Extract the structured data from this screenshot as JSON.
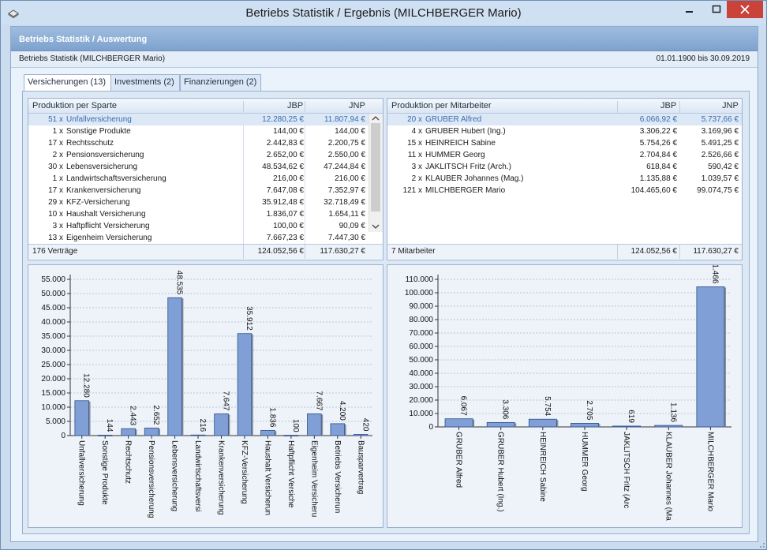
{
  "window": {
    "title": "Betriebs Statistik / Ergebnis (MILCHBERGER Mario)"
  },
  "header": {
    "title": "Betriebs Statistik / Auswertung"
  },
  "subheader": {
    "left": "Betriebs Statistik (MILCHBERGER Mario)",
    "right": "01.01.1900 bis 30.09.2019"
  },
  "tabs": [
    {
      "label": "Versicherungen (13)",
      "active": true
    },
    {
      "label": "Investments (2)",
      "active": false
    },
    {
      "label": "Finanzierungen (2)",
      "active": false
    }
  ],
  "sparte_grid": {
    "columns": [
      "Produktion per Sparte",
      "JBP",
      "JNP"
    ],
    "rows": [
      {
        "count": "51 x",
        "name": "Unfallversicherung",
        "jbp": "12.280,25 €",
        "jnp": "11.807,94 €",
        "selected": true
      },
      {
        "count": "1 x",
        "name": "Sonstige Produkte",
        "jbp": "144,00 €",
        "jnp": "144,00 €"
      },
      {
        "count": "17 x",
        "name": "Rechtsschutz",
        "jbp": "2.442,83 €",
        "jnp": "2.200,75 €"
      },
      {
        "count": "2 x",
        "name": "Pensionsversicherung",
        "jbp": "2.652,00 €",
        "jnp": "2.550,00 €"
      },
      {
        "count": "30 x",
        "name": "Lebensversicherung",
        "jbp": "48.534,62 €",
        "jnp": "47.244,84 €"
      },
      {
        "count": "1 x",
        "name": "Landwirtschaftsversicherung",
        "jbp": "216,00 €",
        "jnp": "216,00 €"
      },
      {
        "count": "17 x",
        "name": "Krankenversicherung",
        "jbp": "7.647,08 €",
        "jnp": "7.352,97 €"
      },
      {
        "count": "29 x",
        "name": "KFZ-Versicherung",
        "jbp": "35.912,48 €",
        "jnp": "32.718,49 €"
      },
      {
        "count": "10 x",
        "name": "Haushalt Versicherung",
        "jbp": "1.836,07 €",
        "jnp": "1.654,11 €"
      },
      {
        "count": "3 x",
        "name": "Haftpflicht Versicherung",
        "jbp": "100,00 €",
        "jnp": "90,09 €"
      },
      {
        "count": "13 x",
        "name": "Eigenheim Versicherung",
        "jbp": "7.667,23 €",
        "jnp": "7.447,30 €"
      }
    ],
    "footer": {
      "label": "176 Verträge",
      "jbp": "124.052,56 €",
      "jnp": "117.630,27 €"
    }
  },
  "mitarbeiter_grid": {
    "columns": [
      "Produktion per Mitarbeiter",
      "JBP",
      "JNP"
    ],
    "rows": [
      {
        "count": "20 x",
        "name": "GRUBER Alfred",
        "jbp": "6.066,92 €",
        "jnp": "5.737,66 €",
        "selected": true
      },
      {
        "count": "4 x",
        "name": "GRUBER Hubert (Ing.)",
        "jbp": "3.306,22 €",
        "jnp": "3.169,96 €"
      },
      {
        "count": "15 x",
        "name": "HEINREICH Sabine",
        "jbp": "5.754,26 €",
        "jnp": "5.491,25 €"
      },
      {
        "count": "11 x",
        "name": "HUMMER Georg",
        "jbp": "2.704,84 €",
        "jnp": "2.526,66 €"
      },
      {
        "count": "3 x",
        "name": "JAKLITSCH Fritz (Arch.)",
        "jbp": "618,84 €",
        "jnp": "590,42 €"
      },
      {
        "count": "2 x",
        "name": "KLAUBER Johannes (Mag.)",
        "jbp": "1.135,88 €",
        "jnp": "1.039,57 €"
      },
      {
        "count": "121 x",
        "name": "MILCHBERGER Mario",
        "jbp": "104.465,60 €",
        "jnp": "99.074,75 €"
      }
    ],
    "footer": {
      "label": "7 Mitarbeiter",
      "jbp": "124.052,56 €",
      "jnp": "117.630,27 €"
    }
  },
  "chart_data": [
    {
      "type": "bar",
      "categories": [
        "Unfallversicherung",
        "Sonstige Produkte",
        "Rechtschutz",
        "Pensionsversicherung",
        "Lebensversicherung",
        "Landwirtschaftsversi",
        "Krankenversicherung",
        "KFZ-Versicherung",
        "Haushalt Versicherun",
        "Haftpflicht Versiche",
        "Eigenheim Versicheru",
        "Betriebs Versicherun",
        "Bausparvertrag"
      ],
      "values": [
        12280,
        144,
        2443,
        2652,
        48535,
        216,
        7647,
        35912,
        1836,
        100,
        7667,
        4200,
        420
      ],
      "data_labels": [
        "12.280",
        "144",
        "2.443",
        "2.652",
        "48.535",
        "216",
        "7.647",
        "35.912",
        "1.836",
        "100",
        "7.667",
        "4.200",
        "420"
      ],
      "yticks": [
        "0",
        "5.000",
        "10.000",
        "15.000",
        "20.000",
        "25.000",
        "30.000",
        "35.000",
        "40.000",
        "45.000",
        "50.000",
        "55.000"
      ],
      "ylim": [
        0,
        55000
      ],
      "grid": true,
      "bar_color": "#7f9fd6"
    },
    {
      "type": "bar",
      "categories": [
        "GRUBER Alfred",
        "GRUBER Hubert (Ing.)",
        "HEINREICH Sabine",
        "HUMMER Georg",
        "JAKLITSCH Fritz (Arc",
        "KLAUBER Johannes (Ma",
        "MILCHBERGER Mario"
      ],
      "values": [
        6067,
        3306,
        5754,
        2705,
        619,
        1136,
        104466
      ],
      "data_labels": [
        "6.067",
        "3.306",
        "5.754",
        "2.705",
        "619",
        "1.136",
        "1.466"
      ],
      "yticks": [
        "0",
        "10.000",
        "20.000",
        "30.000",
        "40.000",
        "50.000",
        "60.000",
        "70.000",
        "80.000",
        "90.000",
        "100.000",
        "110.000"
      ],
      "ylim": [
        0,
        110000
      ],
      "grid": true,
      "bar_color": "#7f9fd6"
    }
  ]
}
